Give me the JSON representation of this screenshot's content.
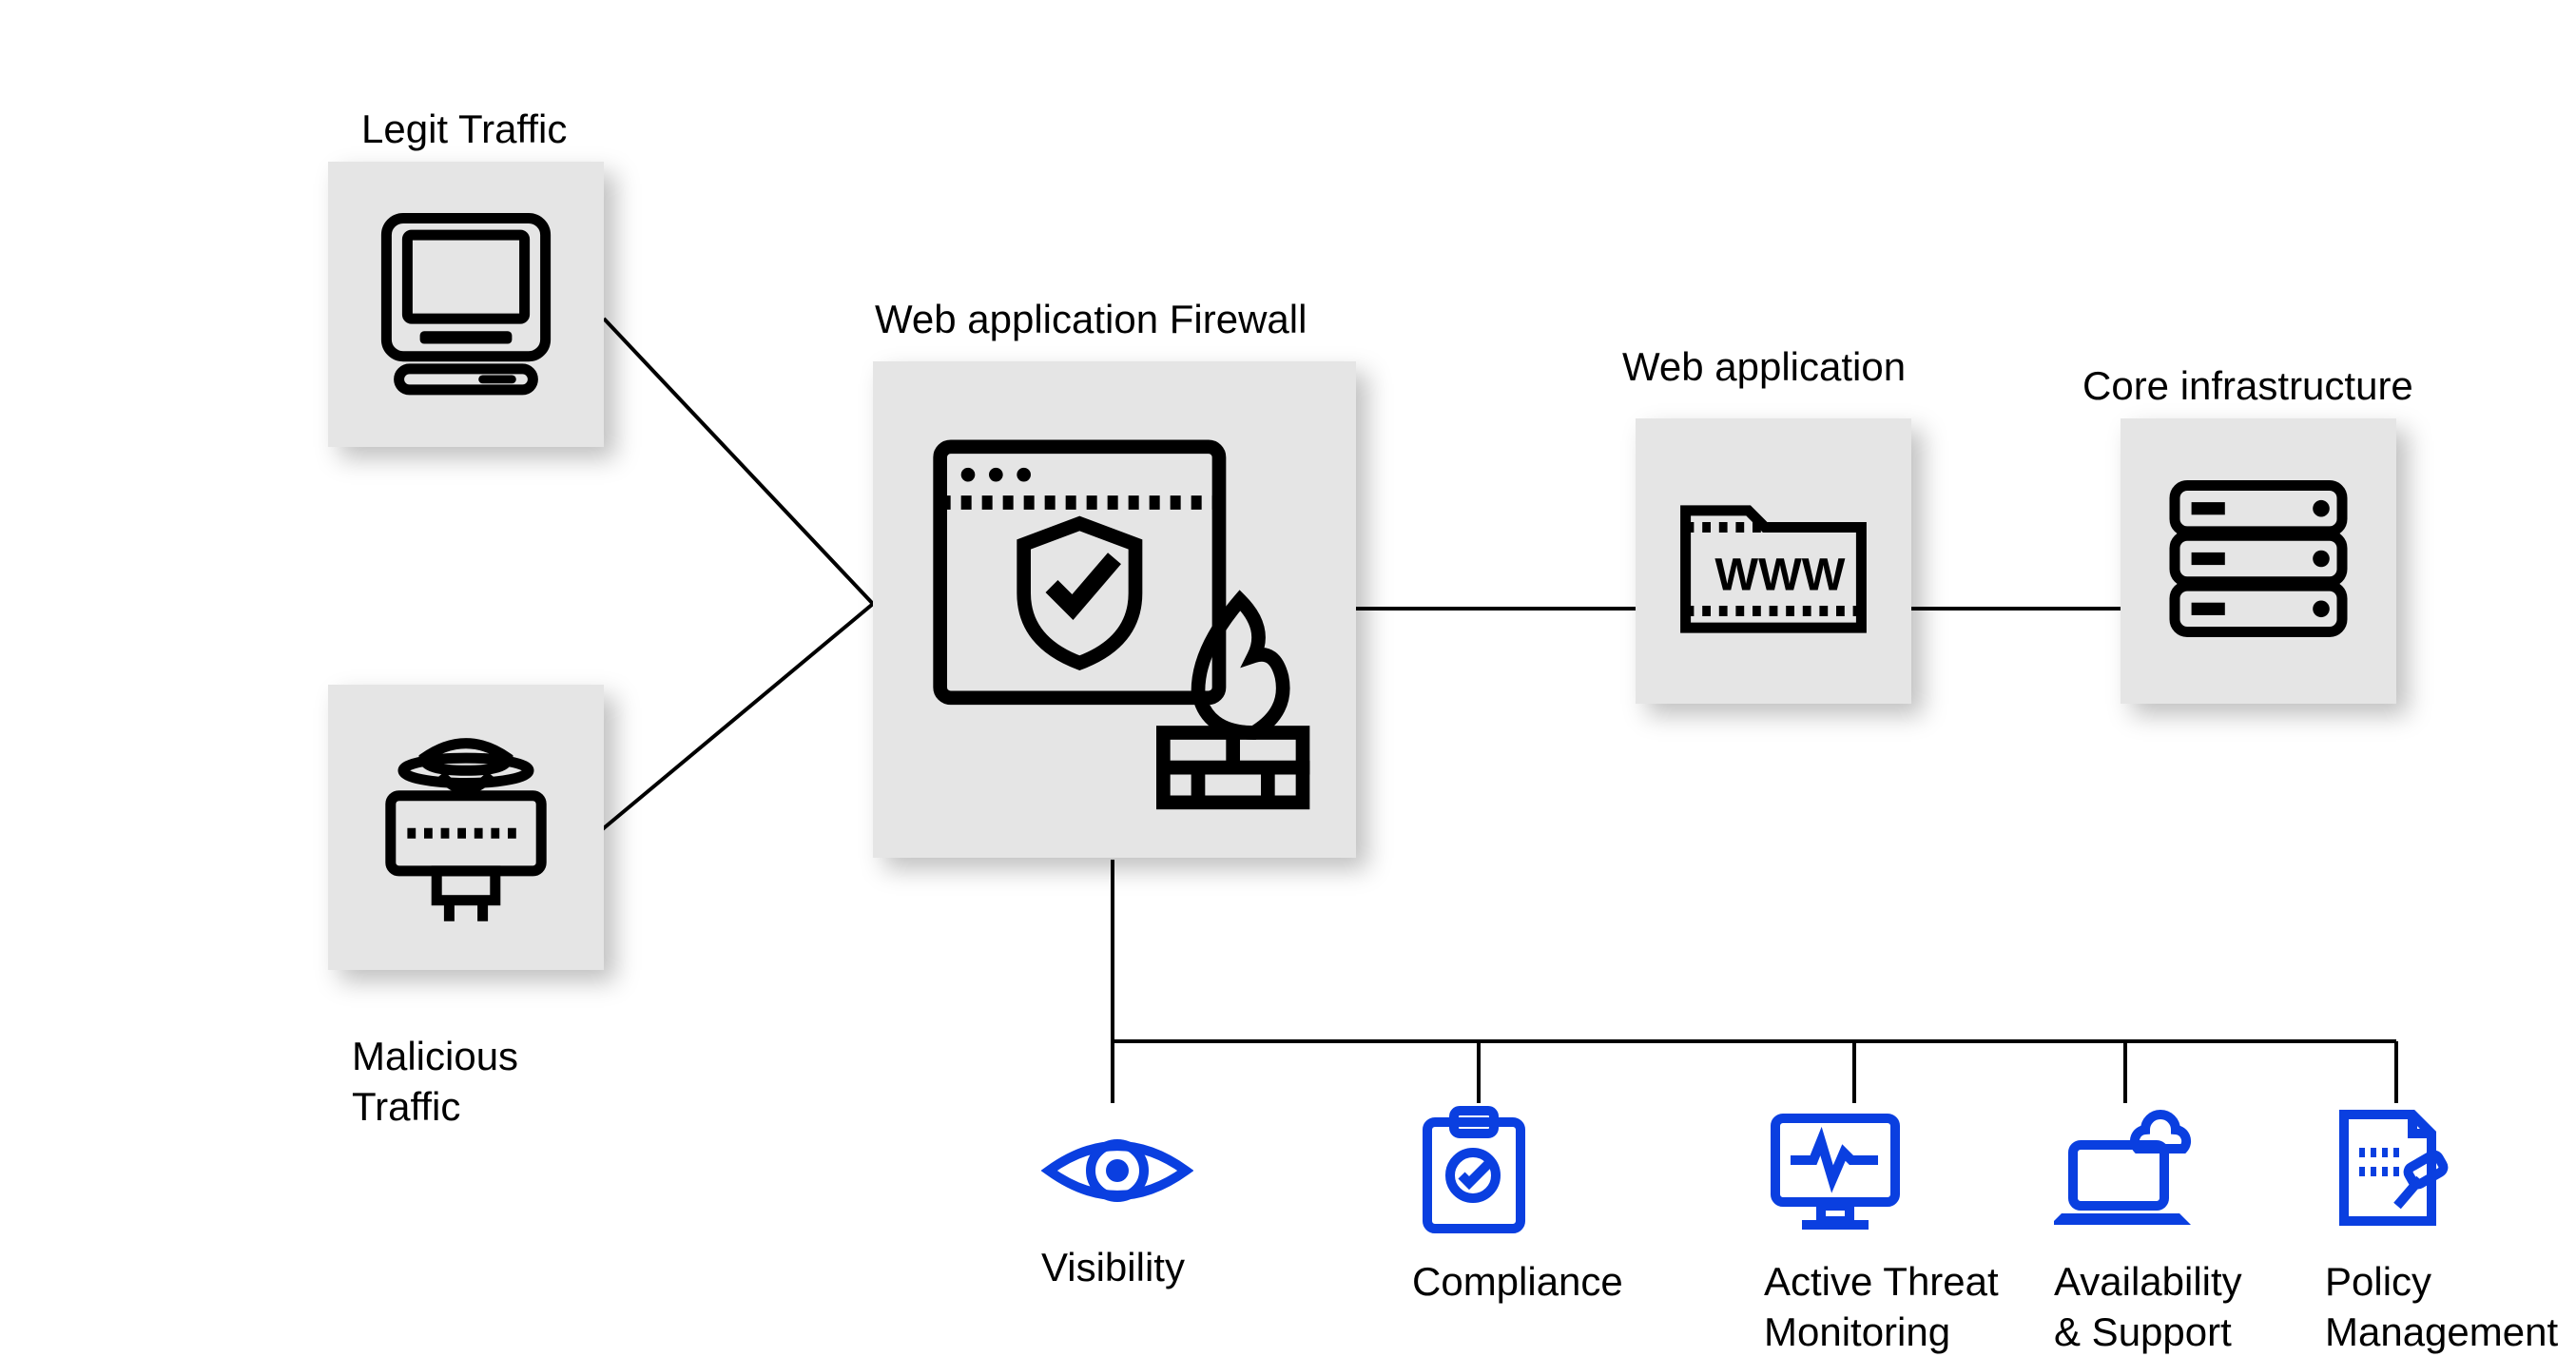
{
  "nodes": {
    "legit": {
      "label": "Legit Traffic"
    },
    "malicious": {
      "label": "Malicious\nTraffic"
    },
    "waf": {
      "label": "Web application Firewall"
    },
    "webapp": {
      "label": "Web application"
    },
    "core": {
      "label": "Core infrastructure"
    }
  },
  "features": [
    {
      "id": "visibility",
      "label": "Visibility",
      "icon": "eye"
    },
    {
      "id": "compliance",
      "label": "Compliance",
      "icon": "clipboard"
    },
    {
      "id": "threat",
      "label": "Active Threat\nMonitoring",
      "icon": "monitor"
    },
    {
      "id": "availability",
      "label": "Availability\n& Support",
      "icon": "laptop-cloud"
    },
    {
      "id": "policy",
      "label": "Policy\nManagement",
      "icon": "doc-gavel"
    }
  ],
  "colors": {
    "icon_blue": "#0a3fe0",
    "box_gray": "#e5e5e5"
  }
}
